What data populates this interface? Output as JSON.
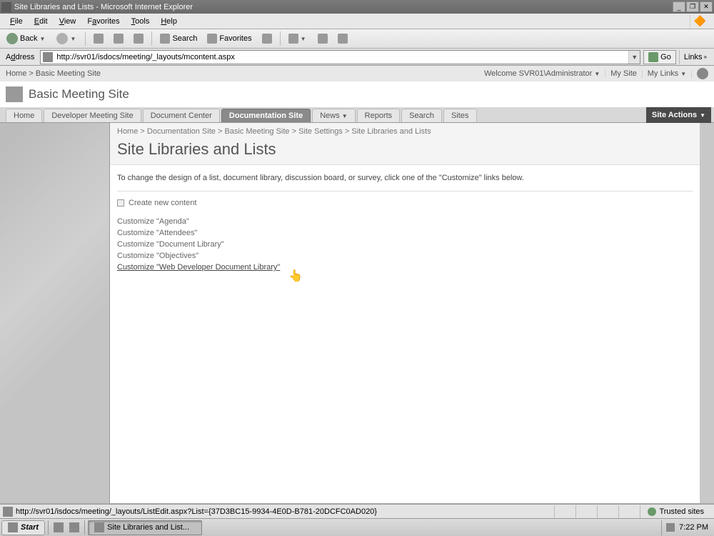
{
  "window": {
    "title": "Site Libraries and Lists - Microsoft Internet Explorer"
  },
  "menubar": {
    "file": "File",
    "edit": "Edit",
    "view": "View",
    "favorites": "Favorites",
    "tools": "Tools",
    "help": "Help"
  },
  "toolbar": {
    "back": "Back",
    "search": "Search",
    "favorites": "Favorites"
  },
  "addressbar": {
    "label": "Address",
    "url": "http://svr01/isdocs/meeting/_layouts/mcontent.aspx",
    "go": "Go",
    "links": "Links"
  },
  "sp_topbar": {
    "home": "Home",
    "site": "Basic Meeting Site",
    "welcome": "Welcome SVR01\\Administrator",
    "mysite": "My Site",
    "mylinks": "My Links"
  },
  "sp_title": "Basic Meeting Site",
  "sp_tabs": {
    "home": "Home",
    "dev": "Developer Meeting Site",
    "doccenter": "Document Center",
    "docsite": "Documentation Site",
    "news": "News",
    "reports": "Reports",
    "search": "Search",
    "sites": "Sites"
  },
  "site_actions": "Site Actions",
  "breadcrumb": {
    "home": "Home",
    "docsite": "Documentation Site",
    "basic": "Basic Meeting Site",
    "settings": "Site Settings",
    "current": "Site Libraries and Lists"
  },
  "page_title": "Site Libraries and Lists",
  "description": "To change the design of a list, document library, discussion board, or survey, click one of the \"Customize\" links below.",
  "create_new": "Create new content",
  "customize_links": [
    "Customize \"Agenda\"",
    "Customize \"Attendees\"",
    "Customize \"Document Library\"",
    "Customize \"Objectives\"",
    "Customize \"Web Developer Document Library\""
  ],
  "statusbar": {
    "url": "http://svr01/isdocs/meeting/_layouts/ListEdit.aspx?List={37D3BC15-9934-4E0D-B781-20DCFC0AD020}",
    "zone": "Trusted sites"
  },
  "taskbar": {
    "start": "Start",
    "task": "Site Libraries and List...",
    "clock": "7:22 PM"
  }
}
